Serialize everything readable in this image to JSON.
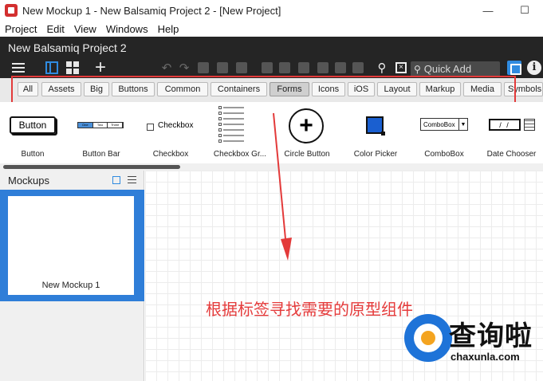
{
  "window": {
    "title": "New Mockup 1 - New Balsamiq Project 2 - [New Project]",
    "controls": {
      "minimize": "—",
      "maximize": "☐"
    }
  },
  "menu": [
    "Project",
    "Edit",
    "View",
    "Windows",
    "Help"
  ],
  "project_name": "New Balsamiq Project 2",
  "toolbar": {
    "quick_add_placeholder": "Quick Add",
    "info": "i"
  },
  "filter_tabs": [
    {
      "label": "All",
      "active": false
    },
    {
      "label": "Assets",
      "active": false
    },
    {
      "label": "Big",
      "active": false
    },
    {
      "label": "Buttons",
      "active": false
    },
    {
      "label": "Common",
      "active": false
    },
    {
      "label": "Containers",
      "active": false
    },
    {
      "label": "Forms",
      "active": true
    },
    {
      "label": "Icons",
      "active": false
    },
    {
      "label": "iOS",
      "active": false
    },
    {
      "label": "Layout",
      "active": false
    },
    {
      "label": "Markup",
      "active": false
    },
    {
      "label": "Media",
      "active": false
    },
    {
      "label": "Symbols",
      "active": false
    }
  ],
  "components": {
    "button": {
      "label": "Button",
      "preview_text": "Button"
    },
    "button_bar": {
      "label": "Button Bar",
      "preview_items": [
        "One",
        "Two",
        "Three"
      ]
    },
    "checkbox": {
      "label": "Checkbox",
      "preview_text": "Checkbox"
    },
    "checkbox_group": {
      "label": "Checkbox Gr..."
    },
    "circle_button": {
      "label": "Circle Button",
      "preview_text": "+"
    },
    "color_picker": {
      "label": "Color Picker"
    },
    "combobox": {
      "label": "ComboBox",
      "preview_text": "ComboBox",
      "arrow": "▼"
    },
    "date_chooser": {
      "label": "Date Chooser",
      "preview_text": "/ /"
    }
  },
  "mockups_panel": {
    "title": "Mockups",
    "items": [
      {
        "label": "New Mockup 1",
        "selected": true
      }
    ]
  },
  "annotation": "根据标签寻找需要的原型组件",
  "watermark": {
    "name": "查询啦",
    "url": "chaxunla.com"
  },
  "colors": {
    "header_dark": "#252525",
    "accent_blue": "#2f7ed8",
    "annotation_red": "#e33a3a"
  }
}
